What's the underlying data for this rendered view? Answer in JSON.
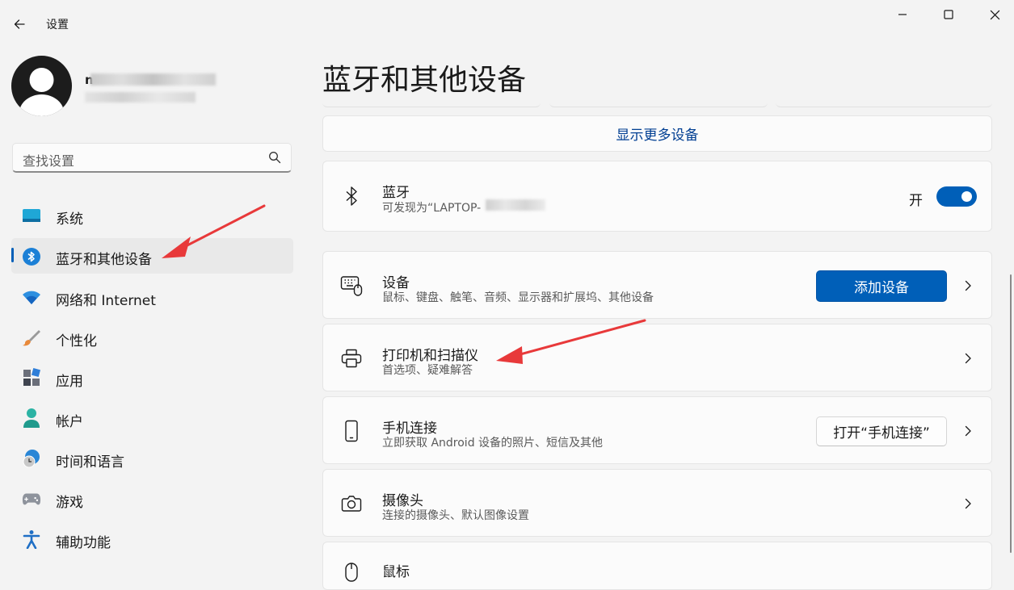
{
  "window": {
    "title": "设置",
    "minimize": "minimize",
    "maximize": "maximize",
    "close": "close"
  },
  "profile": {
    "name": "n"
  },
  "search": {
    "placeholder": "查找设置"
  },
  "nav": [
    {
      "label": "系统",
      "icon": "system-icon"
    },
    {
      "label": "蓝牙和其他设备",
      "icon": "bluetooth-icon",
      "active": true
    },
    {
      "label": "网络和 Internet",
      "icon": "wifi-icon"
    },
    {
      "label": "个性化",
      "icon": "brush-icon"
    },
    {
      "label": "应用",
      "icon": "apps-icon"
    },
    {
      "label": "帐户",
      "icon": "account-icon"
    },
    {
      "label": "时间和语言",
      "icon": "time-language-icon"
    },
    {
      "label": "游戏",
      "icon": "gamepad-icon"
    },
    {
      "label": "辅助功能",
      "icon": "accessibility-icon"
    }
  ],
  "main": {
    "title": "蓝牙和其他设备",
    "show_more": "显示更多设备",
    "bluetooth": {
      "title": "蓝牙",
      "subtitle": "可发现为“LAPTOP-",
      "toggle_state": "开",
      "on": true
    },
    "devices": {
      "title": "设备",
      "subtitle": "鼠标、键盘、触笔、音频、显示器和扩展坞、其他设备",
      "button": "添加设备"
    },
    "printers": {
      "title": "打印机和扫描仪",
      "subtitle": "首选项、疑难解答"
    },
    "phone": {
      "title": "手机连接",
      "subtitle": "立即获取 Android 设备的照片、短信及其他",
      "button": "打开“手机连接”"
    },
    "camera": {
      "title": "摄像头",
      "subtitle": "连接的摄像头、默认图像设置"
    },
    "mouse": {
      "title": "鼠标"
    }
  },
  "colors": {
    "accent": "#005fb8",
    "annotation_arrow": "#e8393a",
    "background": "#f3f3f3",
    "card": "#fbfbfb"
  }
}
